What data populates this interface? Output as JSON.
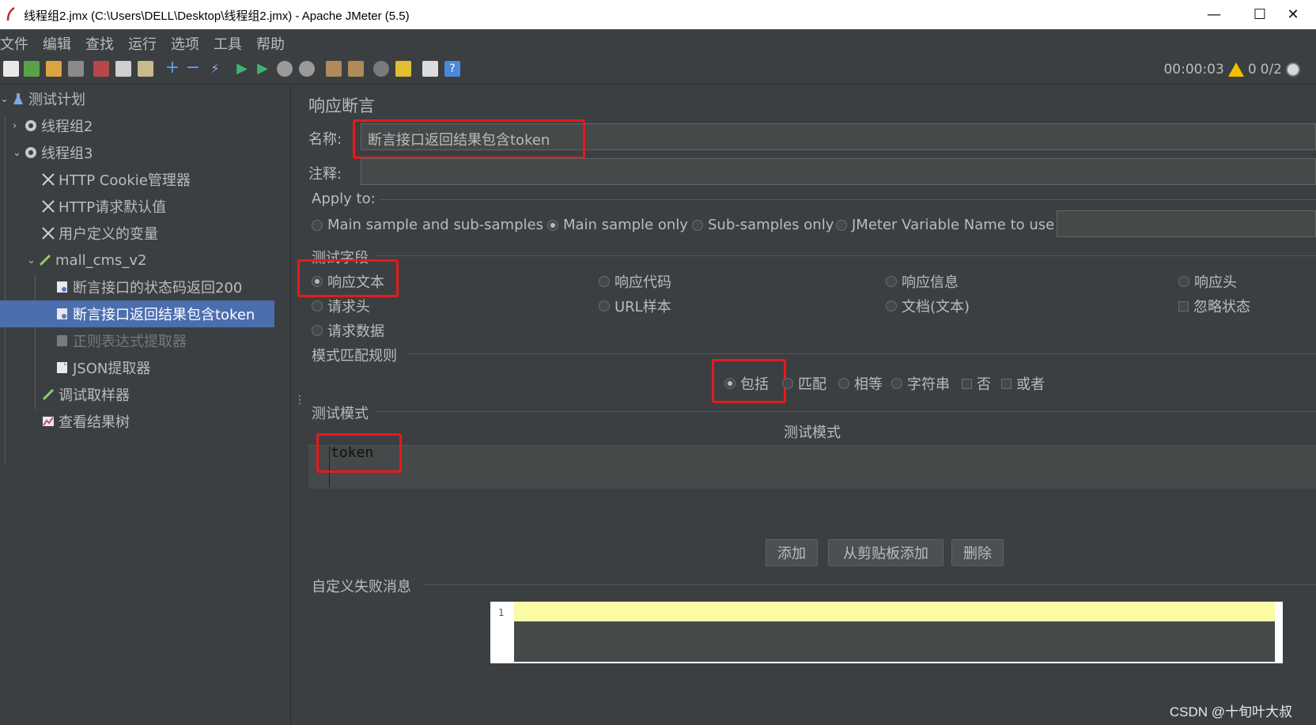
{
  "window": {
    "title": "线程组2.jmx (C:\\Users\\DELL\\Desktop\\线程组2.jmx) - Apache JMeter (5.5)",
    "minimize_glyph": "—",
    "maximize_glyph": "☐",
    "close_glyph": "✕"
  },
  "menu": [
    "文件",
    "编辑",
    "查找",
    "运行",
    "选项",
    "工具",
    "帮助"
  ],
  "toolbar": {
    "timer": "00:00:03",
    "warnings": "0",
    "threads": "0/2"
  },
  "tree": {
    "items": [
      {
        "label": "测试计划",
        "icon": "flask-icon"
      },
      {
        "label": "线程组2",
        "icon": "gear-icon"
      },
      {
        "label": "线程组3",
        "icon": "gear-icon"
      },
      {
        "label": "HTTP Cookie管理器",
        "icon": "tools-icon"
      },
      {
        "label": "HTTP请求默认值",
        "icon": "tools-icon"
      },
      {
        "label": "用户定义的变量",
        "icon": "tools-icon"
      },
      {
        "label": "mall_cms_v2",
        "icon": "pipette-icon"
      },
      {
        "label": "断言接口的状态码返回200",
        "icon": "assertion-icon"
      },
      {
        "label": "断言接口返回结果包含token",
        "icon": "assertion-icon"
      },
      {
        "label": "正则表达式提取器",
        "icon": "extractor-icon"
      },
      {
        "label": "JSON提取器",
        "icon": "extractor-icon"
      },
      {
        "label": "调试取样器",
        "icon": "pipette-icon"
      },
      {
        "label": "查看结果树",
        "icon": "chart-icon"
      }
    ]
  },
  "panel": {
    "title": "响应断言",
    "name_label": "名称:",
    "name_value": "断言接口返回结果包含token",
    "comment_label": "注释:",
    "comment_value": "",
    "apply_to": {
      "label": "Apply to:",
      "options": [
        "Main sample and sub-samples",
        "Main sample only",
        "Sub-samples only",
        "JMeter Variable Name to use"
      ],
      "selected": "Main sample only",
      "variable_value": ""
    },
    "test_field": {
      "label": "测试字段",
      "options": [
        "响应文本",
        "响应代码",
        "响应信息",
        "响应头",
        "请求头",
        "URL样本",
        "文档(文本)",
        "忽略状态",
        "请求数据"
      ],
      "selected": "响应文本"
    },
    "match_rules": {
      "label": "模式匹配规则",
      "options": [
        "包括",
        "匹配",
        "相等",
        "字符串",
        "否",
        "或者"
      ],
      "selected": "包括"
    },
    "patterns": {
      "label": "测试模式",
      "column": "测试模式",
      "rows": [
        "token"
      ]
    },
    "buttons": [
      "添加",
      "从剪贴板添加",
      "删除"
    ],
    "failure_message": {
      "label": "自定义失败消息",
      "line_number": "1",
      "value": ""
    }
  },
  "watermark": "CSDN @十旬叶大叔"
}
